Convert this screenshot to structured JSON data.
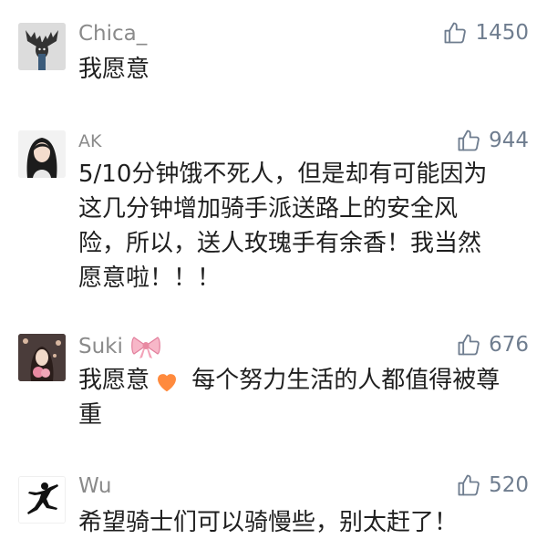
{
  "comments": [
    {
      "user": "Chica_",
      "likes": "1450",
      "lines": [
        "我愿意"
      ],
      "avatar_icon": "moose-avatar-icon"
    },
    {
      "user": "AK",
      "likes": "944",
      "lines": [
        "5/10分钟饿不死人，但是却有可能因为",
        "这几分钟增加骑手派送路上的安全风",
        "险，所以，送人玫瑰手有余香！我当然",
        "愿意啦！！！"
      ],
      "avatar_icon": "girl-avatar-icon"
    },
    {
      "user": "Suki",
      "likes": "676",
      "line1_before_emoji": "我愿意",
      "line1_after_emoji": " 每个努力生活的人都值得被尊",
      "line2": "重",
      "avatar_icon": "girl-flowers-avatar-icon",
      "name_emoji": "ribbon-bow-icon",
      "text_emoji": "orange-heart-icon"
    },
    {
      "user": "Wu",
      "likes": "520",
      "lines": [
        "希望骑士们可以骑慢些，别太赶了！"
      ],
      "avatar_icon": "jumpman-logo-icon"
    }
  ],
  "colors": {
    "username": "#8a8a8a",
    "like": "#6f7d8f",
    "text": "#1f1f1f",
    "background": "#ffffff"
  }
}
